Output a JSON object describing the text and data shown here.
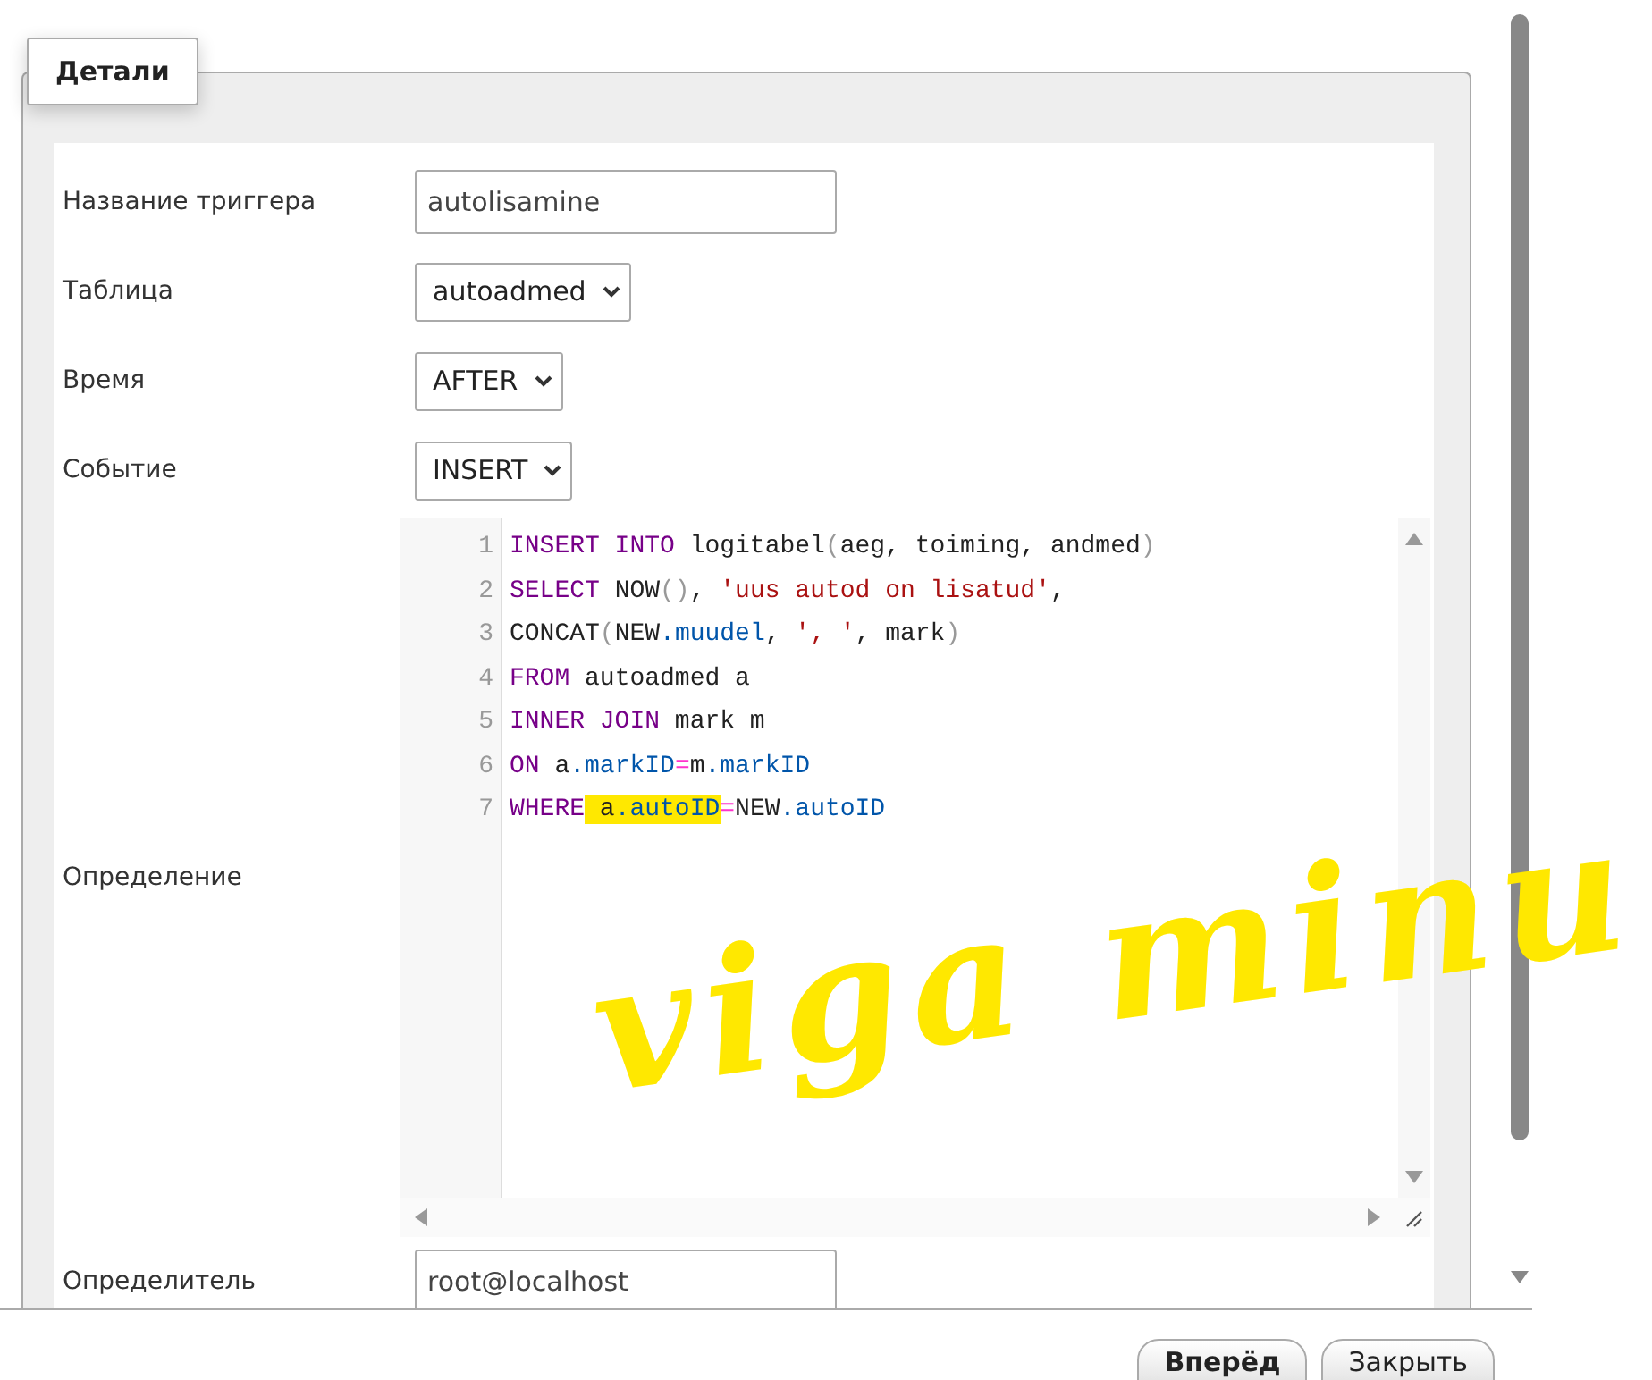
{
  "section": {
    "legend": "Детали"
  },
  "fields": [
    {
      "kind": "text",
      "label": "Название триггера",
      "value": "autolisamine"
    },
    {
      "kind": "select",
      "label": "Таблица",
      "value": "autoadmed"
    },
    {
      "kind": "select",
      "label": "Время",
      "value": "AFTER"
    },
    {
      "kind": "select",
      "label": "Событие",
      "value": "INSERT"
    }
  ],
  "definition": {
    "label": "Определение",
    "lines": [
      {
        "number": "1",
        "tokens": [
          {
            "kind": "keyword",
            "text": "INSERT INTO"
          },
          {
            "kind": "plain",
            "text": " logitabel"
          },
          {
            "kind": "paren",
            "text": "("
          },
          {
            "kind": "plain",
            "text": "aeg, toiming, andmed"
          },
          {
            "kind": "paren",
            "text": ")"
          }
        ]
      },
      {
        "number": "2",
        "tokens": [
          {
            "kind": "keyword",
            "text": "SELECT"
          },
          {
            "kind": "plain",
            "text": " NOW"
          },
          {
            "kind": "paren",
            "text": "()"
          },
          {
            "kind": "plain",
            "text": ", "
          },
          {
            "kind": "string",
            "text": "'uus autod on lisatud'"
          },
          {
            "kind": "plain",
            "text": ","
          }
        ]
      },
      {
        "number": "3",
        "tokens": [
          {
            "kind": "plain",
            "text": "CONCAT"
          },
          {
            "kind": "paren",
            "text": "("
          },
          {
            "kind": "plain",
            "text": "NEW"
          },
          {
            "kind": "field",
            "text": ".muudel"
          },
          {
            "kind": "plain",
            "text": ", "
          },
          {
            "kind": "string",
            "text": "', '"
          },
          {
            "kind": "plain",
            "text": ", mark"
          },
          {
            "kind": "paren",
            "text": ")"
          }
        ]
      },
      {
        "number": "4",
        "tokens": [
          {
            "kind": "keyword",
            "text": "FROM"
          },
          {
            "kind": "plain",
            "text": " autoadmed a"
          }
        ]
      },
      {
        "number": "5",
        "tokens": [
          {
            "kind": "keyword",
            "text": "INNER JOIN"
          },
          {
            "kind": "plain",
            "text": " mark m"
          }
        ]
      },
      {
        "number": "6",
        "tokens": [
          {
            "kind": "keyword",
            "text": "ON"
          },
          {
            "kind": "plain",
            "text": " a"
          },
          {
            "kind": "field",
            "text": ".markID"
          },
          {
            "kind": "op",
            "text": "="
          },
          {
            "kind": "plain",
            "text": "m"
          },
          {
            "kind": "field",
            "text": ".markID"
          }
        ]
      },
      {
        "number": "7",
        "tokens": [
          {
            "kind": "keyword",
            "text": "WHERE"
          },
          {
            "kind": "plain",
            "text": " a",
            "highlighted": true
          },
          {
            "kind": "field",
            "text": ".autoID",
            "highlighted": true
          },
          {
            "kind": "op",
            "text": "="
          },
          {
            "kind": "plain",
            "text": "NEW"
          },
          {
            "kind": "field",
            "text": ".autoID"
          }
        ]
      }
    ]
  },
  "definer": {
    "label": "Определитель",
    "value": "root@localhost"
  },
  "annotation": {
    "text": "viga minu"
  },
  "buttons": [
    {
      "label": "Вперёд",
      "primary": true
    },
    {
      "label": "Закрыть",
      "primary": false
    }
  ]
}
